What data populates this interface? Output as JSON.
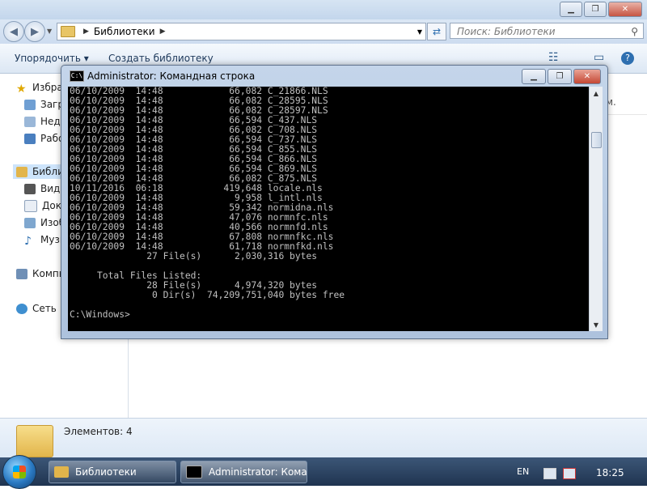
{
  "explorer": {
    "address": {
      "path": "Библиотеки"
    },
    "search": {
      "placeholder": "Поиск: Библиотеки"
    },
    "toolbar": {
      "organize": "Упорядочить ▾",
      "new_library": "Создать библиотеку"
    },
    "nav": [
      {
        "label": "Избра"
      },
      {
        "label": "Загр"
      },
      {
        "label": "Неда"
      },
      {
        "label": "Рабо"
      },
      {
        "label": "Библи"
      },
      {
        "label": "Виде"
      },
      {
        "label": "Доку"
      },
      {
        "label": "Изоб"
      },
      {
        "label": "Музы"
      },
      {
        "label": "Компь"
      },
      {
        "label": "Сеть"
      }
    ],
    "content_fragment": "м.",
    "details": {
      "items": "Элементов: 4"
    }
  },
  "cmd": {
    "title": "Administrator: Командная строка",
    "console_lines": [
      "06/10/2009  14:48            66,082 C_21866.NLS",
      "06/10/2009  14:48            66,082 C_28595.NLS",
      "06/10/2009  14:48            66,082 C_28597.NLS",
      "06/10/2009  14:48            66,594 C_437.NLS",
      "06/10/2009  14:48            66,082 C_708.NLS",
      "06/10/2009  14:48            66,594 C_737.NLS",
      "06/10/2009  14:48            66,594 C_855.NLS",
      "06/10/2009  14:48            66,594 C_866.NLS",
      "06/10/2009  14:48            66,594 C_869.NLS",
      "06/10/2009  14:48            66,082 C_875.NLS",
      "10/11/2016  06:18           419,648 locale.nls",
      "06/10/2009  14:48             9,958 l_intl.nls",
      "06/10/2009  14:48            59,342 normidna.nls",
      "06/10/2009  14:48            47,076 normnfc.nls",
      "06/10/2009  14:48            40,566 normnfd.nls",
      "06/10/2009  14:48            67,808 normnfkc.nls",
      "06/10/2009  14:48            61,718 normnfkd.nls",
      "              27 File(s)      2,030,316 bytes",
      "",
      "     Total Files Listed:",
      "              28 File(s)      4,974,320 bytes",
      "               0 Dir(s)  74,209,751,040 bytes free",
      "",
      "C:\\Windows>"
    ]
  },
  "taskbar": {
    "items": [
      {
        "label": "Библиотеки"
      },
      {
        "label": "Administrator: Кома..."
      }
    ],
    "language": "EN",
    "clock": "18:25"
  },
  "colors": {
    "console_bg": "#000000",
    "console_fg": "#c0c0c0",
    "taskbar": "#2a4466",
    "selection": "#cde4fb"
  }
}
